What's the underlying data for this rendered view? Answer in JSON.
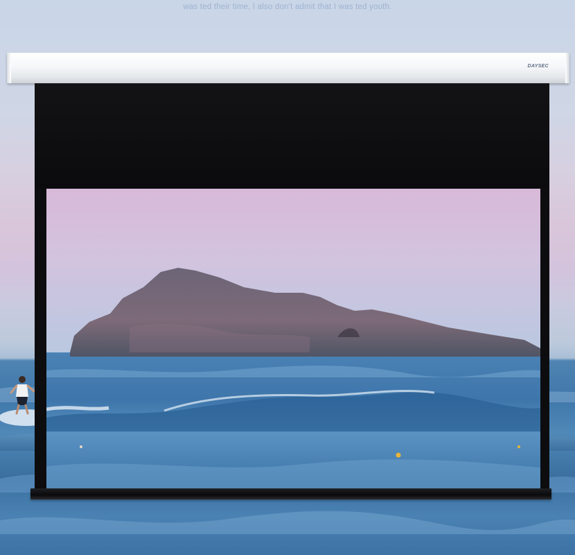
{
  "caption": "was ted their time, I also don't admit that I was ted  youth.",
  "brand_logo_text": "DAYSEC",
  "colors": {
    "sky_top": "#c9d6e8",
    "sky_pink": "#d9c6da",
    "sea": "#3f78aa",
    "screen_black": "#0d0d0f",
    "case_white": "#f6f7f9"
  },
  "icons": {
    "surfer": "surfer-figure",
    "island": "island-rock"
  }
}
